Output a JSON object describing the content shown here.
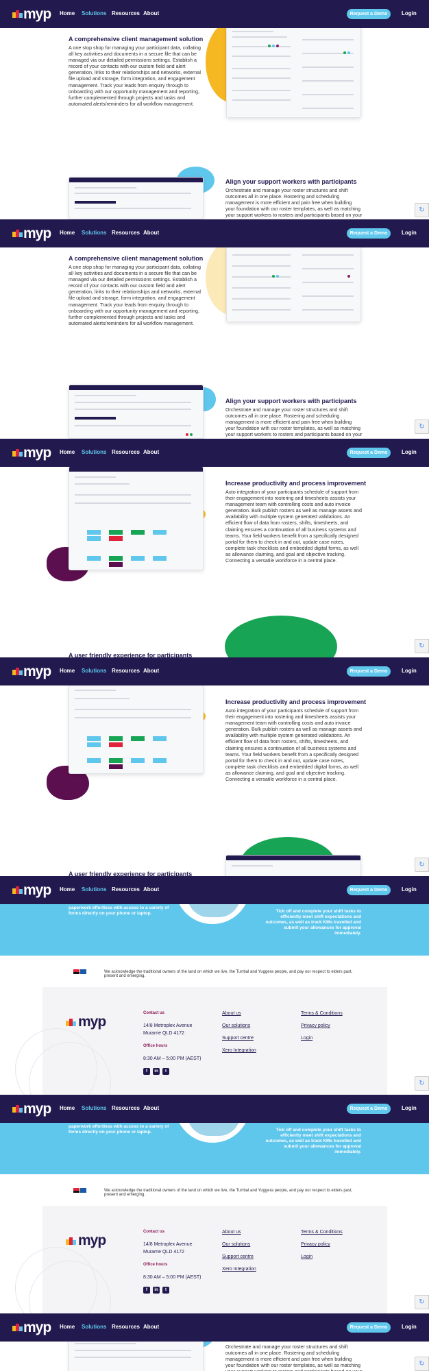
{
  "nav": {
    "logo_text": "myp",
    "items": [
      "Home",
      "Solutions",
      "Resources",
      "About"
    ],
    "active": "Solutions",
    "demo_label": "Request a Demo",
    "login_label": "Login"
  },
  "client": {
    "heading": "A comprehensive client management solution",
    "body": "A one stop shop for managing your participant data, collating all key activities and documents in a secure file that can be managed via our detailed permissions settings.  Establish a record of your contacts with our custom field and alert generation, links to their relationships and networks, external file upload and storage, form integration, and engagement management.  Track your leads from enquiry through to onboarding with our opportunity management and reporting, further complemented through projects and tasks and automated alerts/reminders for all workflow management."
  },
  "roster": {
    "heading": "Align your support workers with participants",
    "body": "Orchestrate and manage your roster structures and shift outcomes all in one place.  Rostering and scheduling management is more efficient and pain free when building your foundation with our roster templates, as well as matching your support workers to rosters and participants based on your"
  },
  "productivity": {
    "heading": "Increase productivity and process improvement",
    "body": "Auto integration of your participants schedule of support from their engagement into rostering and timesheets assists your management team with controlling costs and auto invoice generation.  Bulk publish rosters as well as manage assets and availability with multiple system generated validations.  An efficient flow of data from rosters, shifts, timesheets, and claiming ensures a continuation of all business systems and teams. Your field workers benefit from a specifically designed portal for them to check in and out, update case notes, complete task checklists and embedded digital forms, as well as allowance claiming, and goal and objective tracking. Connecting a versatile workforce in a central place."
  },
  "friendly_heading": "A user friendly experience for participants",
  "app_promo": {
    "left_text": "paperwork effortless with access to a variety of forms directly on your phone or laptop.",
    "right_text": "Tick off and complete your shift tasks to efficiently meet shift expectations and outcomes, as well as track KMs travelled and submit your allowances for approval immediately."
  },
  "acknowledgement": "We acknowledge the traditional owners of the land on which we live, the Turrbal and Yuggera people, and pay our respect to elders past, present and emerging.",
  "footer": {
    "logo_text": "myp",
    "contact_heading": "Contact us",
    "address_line1": "14/8 Metroplex Avenue",
    "address_line2": "Murarrie QLD 4172",
    "hours_heading": "Office hours",
    "hours": "8:30 AM – 5:00 PM (AEST)",
    "links_col1": [
      "About us",
      "Our solutions",
      "Support centre",
      "Xero Integration"
    ],
    "links_col2": [
      "Terms & Conditions",
      "Privacy policy",
      "Login"
    ],
    "social": [
      "f",
      "in",
      "t"
    ]
  },
  "colors": {
    "navy": "#221a4e",
    "sky": "#5fc6ec",
    "plum": "#5c0f4e",
    "yellow": "#f5b722",
    "green": "#17a454"
  },
  "icons": [
    "recaptcha-icon",
    "facebook-icon",
    "linkedin-icon",
    "twitter-icon",
    "aboriginal-flag-icon"
  ]
}
